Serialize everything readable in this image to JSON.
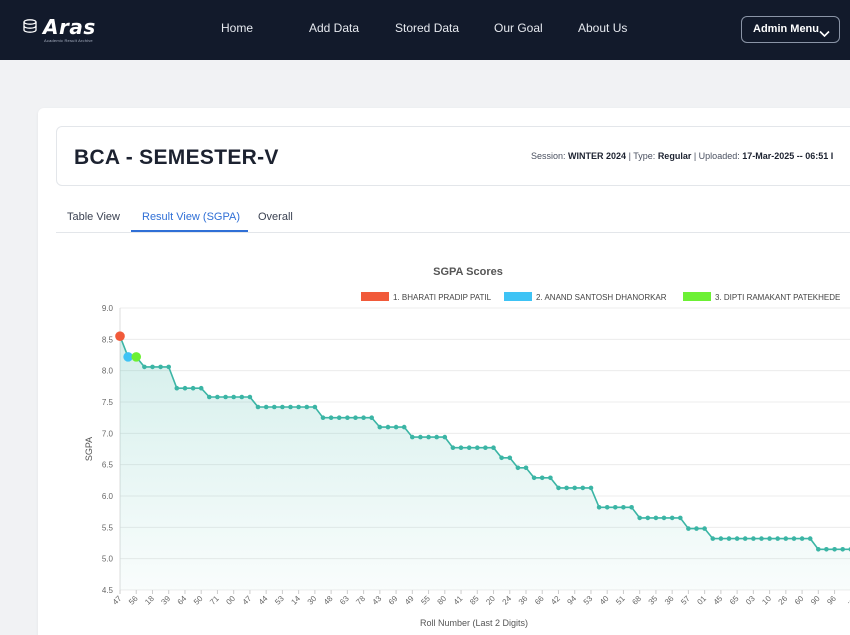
{
  "navbar": {
    "logo_text": "Aras",
    "logo_subtext": "Academic Result Archive",
    "links": [
      "Home",
      "Add Data",
      "Stored Data",
      "Our Goal",
      "About Us"
    ],
    "admin_menu_label": "Admin Menu",
    "colors": {
      "background": "#121a2b",
      "text": "#ffffff"
    }
  },
  "header": {
    "title": "BCA - SEMESTER-V",
    "session_label": "Session:",
    "session_value": "WINTER 2024",
    "type_label": "| Type:",
    "type_value": "Regular",
    "uploaded_label": "| Uploaded:",
    "uploaded_value": "17-Mar-2025 -- 06:51 I"
  },
  "tabs": [
    {
      "label": "Table View",
      "active": false
    },
    {
      "label": "Result View (SGPA)",
      "active": true
    },
    {
      "label": "Overall",
      "active": false
    }
  ],
  "accent_color": "#2f6fd6",
  "chart_data": {
    "type": "line",
    "title": "SGPA Scores",
    "xlabel": "Roll Number (Last 2 Digits)",
    "ylabel": "SGPA",
    "ylim": [
      4.5,
      9.0
    ],
    "yticks": [
      "9.0",
      "8.5",
      "8.0",
      "7.5",
      "7.0",
      "6.5",
      "6.0",
      "5.5",
      "5.0",
      "4.5"
    ],
    "grid": true,
    "legend_position": "top",
    "line_color": "#3bb5a5",
    "fill": true,
    "legend": [
      {
        "label": "1. BHARATI PRADIP PATIL",
        "color": "#f15a3a"
      },
      {
        "label": "2. ANAND SANTOSH DHANORKAR",
        "color": "#3ec3f5"
      },
      {
        "label": "3. DIPTI RAMAKANT PATEKHEDE",
        "color": "#6cf034"
      }
    ],
    "x_tick_labels": [
      "47",
      "56",
      "18",
      "39",
      "64",
      "50",
      "71",
      "00",
      "47",
      "44",
      "53",
      "14",
      "30",
      "48",
      "63",
      "78",
      "43",
      "69",
      "49",
      "55",
      "80",
      "41",
      "85",
      "20",
      "24",
      "36",
      "66",
      "42",
      "94",
      "53",
      "40",
      "51",
      "68",
      "35",
      "36",
      "57",
      "01",
      "45",
      "65",
      "03",
      "10",
      "26",
      "60",
      "90",
      "96",
      "..."
    ],
    "highlights": [
      {
        "rank": 1,
        "index": 0,
        "color": "#f15a3a"
      },
      {
        "rank": 2,
        "index": 1,
        "color": "#3ec3f5"
      },
      {
        "rank": 3,
        "index": 2,
        "color": "#6cf034"
      }
    ],
    "values": [
      8.55,
      8.22,
      8.22,
      8.06,
      8.06,
      8.06,
      8.06,
      7.72,
      7.72,
      7.72,
      7.72,
      7.58,
      7.58,
      7.58,
      7.58,
      7.58,
      7.58,
      7.42,
      7.42,
      7.42,
      7.42,
      7.42,
      7.42,
      7.42,
      7.42,
      7.25,
      7.25,
      7.25,
      7.25,
      7.25,
      7.25,
      7.25,
      7.1,
      7.1,
      7.1,
      7.1,
      6.94,
      6.94,
      6.94,
      6.94,
      6.94,
      6.77,
      6.77,
      6.77,
      6.77,
      6.77,
      6.77,
      6.61,
      6.61,
      6.45,
      6.45,
      6.29,
      6.29,
      6.29,
      6.13,
      6.13,
      6.13,
      6.13,
      6.13,
      5.82,
      5.82,
      5.82,
      5.82,
      5.82,
      5.65,
      5.65,
      5.65,
      5.65,
      5.65,
      5.65,
      5.48,
      5.48,
      5.48,
      5.32,
      5.32,
      5.32,
      5.32,
      5.32,
      5.32,
      5.32,
      5.32,
      5.32,
      5.32,
      5.32,
      5.32,
      5.32,
      5.15,
      5.15,
      5.15,
      5.15,
      5.15,
      5.15,
      5.15,
      5.15,
      5.15
    ]
  }
}
